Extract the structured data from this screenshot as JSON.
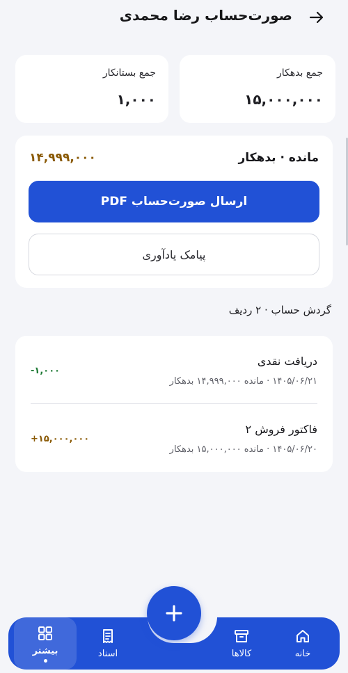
{
  "header": {
    "title": "صورت‌حساب رضا محمدی",
    "back_icon": "arrow-right-icon"
  },
  "summary": {
    "debit_label": "جمع بدهکار",
    "debit_value": "۱۵,۰۰۰,۰۰۰",
    "credit_label": "جمع بستانکار",
    "credit_value": "۱,۰۰۰"
  },
  "balance": {
    "label": "مانده · بدهکار",
    "value": "۱۴,۹۹۹,۰۰۰",
    "value_color": "#8a5a06",
    "send_pdf_label": "ارسال صورت‌حساب PDF",
    "reminder_label": "پیامک یادآوری"
  },
  "transactions_section": {
    "title": "گردش حساب · ۲ ردیف",
    "rows": [
      {
        "title": "دریافت نقدی",
        "subtitle": "۱۴۰۵/۰۶/۲۱ · مانده ۱۴,۹۹۹,۰۰۰ بدهکار",
        "amount": "-۱,۰۰۰",
        "amount_color": "#1e7a35"
      },
      {
        "title": "فاکتور فروش ۲",
        "subtitle": "۱۴۰۵/۰۶/۲۰ · مانده ۱۵,۰۰۰,۰۰۰ بدهکار",
        "amount": "+۱۵,۰۰۰,۰۰۰",
        "amount_color": "#8a5a06"
      }
    ]
  },
  "bottom_nav": {
    "items": [
      {
        "label": "خانه",
        "icon": "home-icon"
      },
      {
        "label": "کالاها",
        "icon": "archive-box-icon"
      },
      {
        "label": "اسناد",
        "icon": "receipt-icon"
      },
      {
        "label": "بیشتر",
        "icon": "grid-icon",
        "active": true
      }
    ],
    "fab_icon": "plus-icon"
  },
  "colors": {
    "accent": "#2151d6",
    "background": "#f4f5f9"
  }
}
